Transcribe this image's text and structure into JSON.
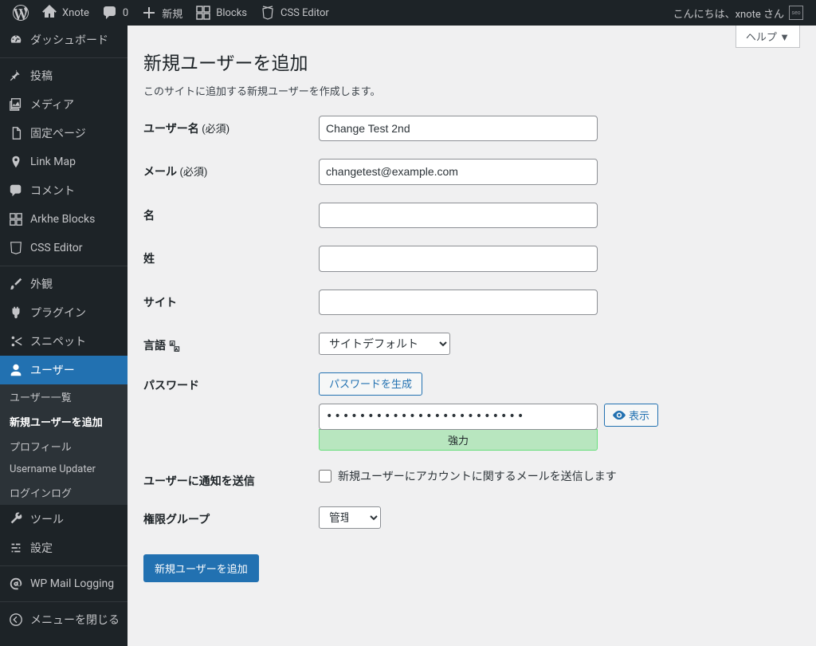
{
  "adminbar": {
    "site": "Xnote",
    "comments": "0",
    "new": "新規",
    "blocks": "Blocks",
    "csseditor": "CSS Editor",
    "greeting": "こんにちは、xnote さん",
    "avatar_abbrev": "seo"
  },
  "sidebar": {
    "dashboard": "ダッシュボード",
    "posts": "投稿",
    "media": "メディア",
    "pages": "固定ページ",
    "linkmap": "Link Map",
    "comments": "コメント",
    "arkhe": "Arkhe Blocks",
    "csseditor": "CSS Editor",
    "appearance": "外観",
    "plugins": "プラグイン",
    "snippets": "スニペット",
    "users": "ユーザー",
    "users_sub": {
      "all": "ユーザー一覧",
      "addnew": "新規ユーザーを追加",
      "profile": "プロフィール",
      "username_updater": "Username Updater",
      "loginlog": "ログインログ"
    },
    "tools": "ツール",
    "settings": "設定",
    "wpmaillog": "WP Mail Logging",
    "collapse": "メニューを閉じる"
  },
  "page": {
    "help": "ヘルプ ▼",
    "title": "新規ユーザーを追加",
    "desc": "このサイトに追加する新規ユーザーを作成します。"
  },
  "form": {
    "username_label": "ユーザー名",
    "required": "(必須)",
    "username_value": "Change Test 2nd",
    "email_label": "メール",
    "email_value": "changetest@example.com",
    "firstname_label": "名",
    "lastname_label": "姓",
    "website_label": "サイト",
    "language_label": "言語",
    "language_option": "サイトデフォルト",
    "password_label": "パスワード",
    "generate_btn": "パスワードを生成",
    "password_value": "••••••••••••••••••••••••",
    "show_btn": "表示",
    "strength": "強力",
    "notify_label": "ユーザーに通知を送信",
    "notify_checkbox": "新規ユーザーにアカウントに関するメールを送信します",
    "role_label": "権限グループ",
    "role_option": "管理者",
    "submit": "新規ユーザーを追加"
  }
}
